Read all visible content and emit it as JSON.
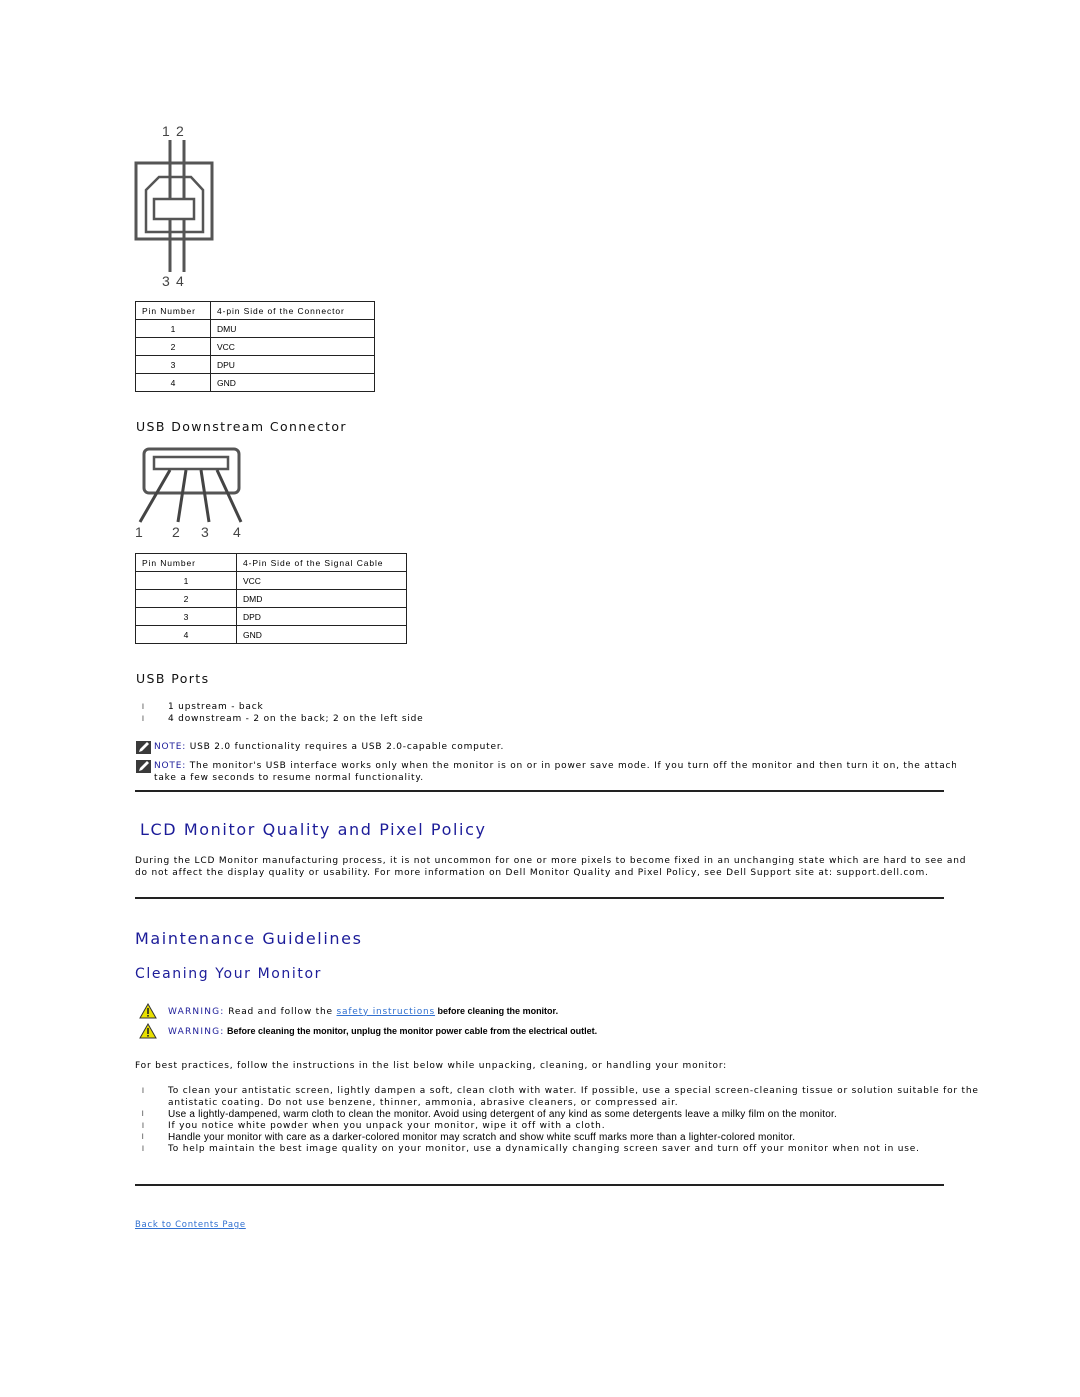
{
  "upstream": {
    "diagram_labels": {
      "top": [
        "1",
        "2"
      ],
      "bottom": [
        "3",
        "4"
      ]
    },
    "table": {
      "headers": [
        "Pin Number",
        "4-pin Side of the Connector"
      ],
      "rows": [
        [
          "1",
          "DMU"
        ],
        [
          "2",
          "VCC"
        ],
        [
          "3",
          "DPU"
        ],
        [
          "4",
          "GND"
        ]
      ]
    }
  },
  "downstream": {
    "title": "USB Downstream Connector",
    "diagram_labels": [
      "1",
      "2",
      "3",
      "4"
    ],
    "table": {
      "headers": [
        "Pin Number",
        "4-Pin Side of the Signal Cable"
      ],
      "rows": [
        [
          "1",
          "VCC"
        ],
        [
          "2",
          "DMD"
        ],
        [
          "3",
          "DPD"
        ],
        [
          "4",
          "GND"
        ]
      ]
    }
  },
  "usb_ports": {
    "title": "USB Ports",
    "items": [
      "1 upstream - back",
      "4 downstream - 2 on the back; 2 on the left side"
    ],
    "notes": [
      {
        "label": "NOTE:",
        "text": " USB 2.0 functionality requires a USB 2.0-capable computer."
      },
      {
        "label": "NOTE:",
        "text": " The monitor's USB interface works only when the monitor is on or in power save mode. If you turn off the monitor and then turn it on, the attached pe",
        "text2": "take a few seconds to resume normal functionality."
      }
    ]
  },
  "pixel_policy": {
    "title": "LCD Monitor Quality and Pixel Policy",
    "line1": "During the LCD Monitor manufacturing process, it is not uncommon for one or more pixels to become fixed in an unchanging state which are hard to see and",
    "line2": "do not affect the display quality or usability. For more information on Dell Monitor Quality and Pixel Policy, see Dell Support site at: support.dell.com."
  },
  "maintenance": {
    "title": "Maintenance Guidelines",
    "subtitle": "Cleaning Your Monitor",
    "warnings": [
      {
        "label": "WARNING:",
        "pre": " Read and follow the ",
        "link": "safety instructions",
        "bold": " before cleaning the monitor."
      },
      {
        "label": "WARNING:",
        "bold": " Before cleaning the monitor, unplug the monitor power cable from the electrical outlet."
      }
    ],
    "intro": "For best practices, follow the instructions in the list below while unpacking, cleaning, or handling your monitor:",
    "items": [
      "To clean your antistatic screen, lightly dampen a soft, clean cloth with water. If possible, use a special screen-cleaning tissue or solution suitable for the",
      "antistatic coating. Do not use benzene, thinner, ammonia, abrasive cleaners, or compressed air.",
      "Use a lightly-dampened, warm cloth to clean the monitor. Avoid using detergent of any kind as some detergents leave a milky film on the monitor.",
      "If you notice white powder when you unpack your monitor, wipe it off with a cloth.",
      "Handle your monitor with care as a darker-colored monitor may scratch and show white scuff marks more than a lighter-colored monitor.",
      "To help maintain the best image quality on your monitor, use a dynamically changing screen saver and turn off your monitor when not in use."
    ]
  },
  "footer": {
    "back_link": "Back to Contents Page"
  },
  "colors": {
    "heading": "#1c1c99",
    "link": "#3070d0",
    "rule": "#222222"
  }
}
